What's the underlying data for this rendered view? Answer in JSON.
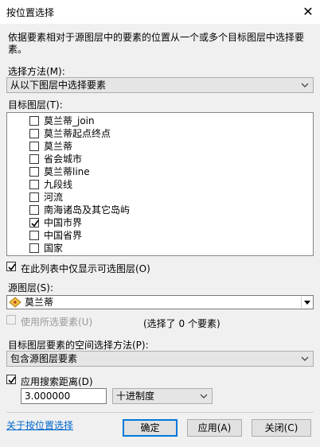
{
  "window": {
    "title": "按位置选择"
  },
  "description": "依据要素相对于源图层中的要素的位置从一个或多个目标图层中选择要素。",
  "selection_method": {
    "label": "选择方法(M):",
    "value": "从以下图层中选择要素"
  },
  "target_layers": {
    "label": "目标图层(T):",
    "items": [
      {
        "label": "莫兰蒂_join",
        "checked": false
      },
      {
        "label": "莫兰蒂起点终点",
        "checked": false
      },
      {
        "label": "莫兰蒂",
        "checked": false
      },
      {
        "label": "省会城市",
        "checked": false
      },
      {
        "label": "莫兰蒂line",
        "checked": false
      },
      {
        "label": "九段线",
        "checked": false
      },
      {
        "label": "河流",
        "checked": false
      },
      {
        "label": "南海诸岛及其它岛屿",
        "checked": false
      },
      {
        "label": "中国市界",
        "checked": true
      },
      {
        "label": "中国省界",
        "checked": false
      },
      {
        "label": "国家",
        "checked": false
      }
    ]
  },
  "only_selectable": {
    "label": "在此列表中仅显示可选图层(O)",
    "checked": true
  },
  "source_layer": {
    "label": "源图层(S):",
    "value": "莫兰蒂"
  },
  "use_selected": {
    "label": "使用所选要素(U)",
    "checked": false,
    "status": "(选择了 0 个要素)"
  },
  "spatial_method": {
    "label": "目标图层要素的空间选择方法(P):",
    "value": "包含源图层要素"
  },
  "search_distance": {
    "label": "应用搜索距离(D)",
    "checked": true,
    "value": "3.000000",
    "unit": "十进制度"
  },
  "footer": {
    "help_link": "关于按位置选择",
    "ok": "确定",
    "apply": "应用(A)",
    "close": "关闭(C)"
  }
}
